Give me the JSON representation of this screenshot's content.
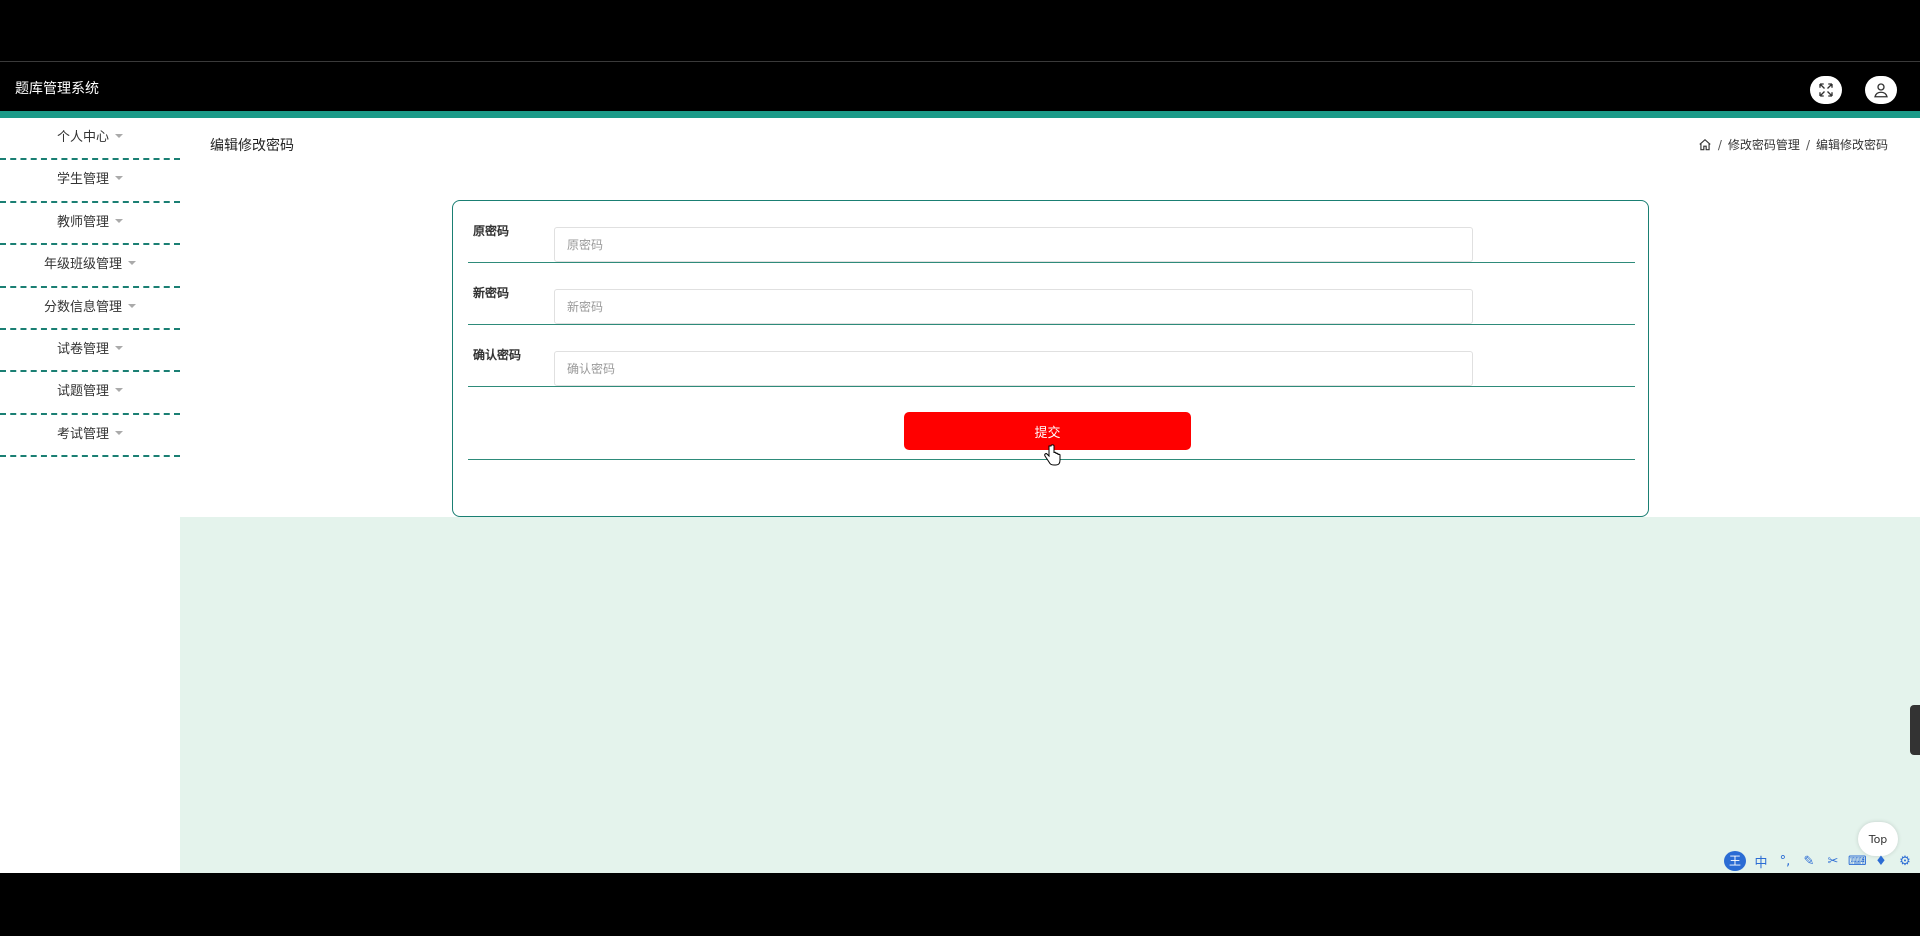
{
  "header": {
    "title": "题库管理系统",
    "fullscreen_icon": "fullscreen-icon",
    "user_icon": "user-icon"
  },
  "sidebar": {
    "items": [
      {
        "label": "个人中心"
      },
      {
        "label": "学生管理"
      },
      {
        "label": "教师管理"
      },
      {
        "label": "年级班级管理"
      },
      {
        "label": "分数信息管理"
      },
      {
        "label": "试卷管理"
      },
      {
        "label": "试题管理"
      },
      {
        "label": "考试管理"
      }
    ]
  },
  "page": {
    "title": "编辑修改密码",
    "breadcrumb": [
      "修改密码管理",
      "编辑修改密码"
    ]
  },
  "form": {
    "fields": [
      {
        "label": "原密码",
        "placeholder": "原密码",
        "value": ""
      },
      {
        "label": "新密码",
        "placeholder": "新密码",
        "value": ""
      },
      {
        "label": "确认密码",
        "placeholder": "确认密码",
        "value": ""
      }
    ],
    "submit_label": "提交"
  },
  "back_to_top": "Top",
  "ime": {
    "logo": "王",
    "mode": "中",
    "punct": "°,"
  },
  "colors": {
    "accent": "#1a9a88",
    "submit": "#ff0000",
    "content_bg": "#e4f3ec"
  }
}
